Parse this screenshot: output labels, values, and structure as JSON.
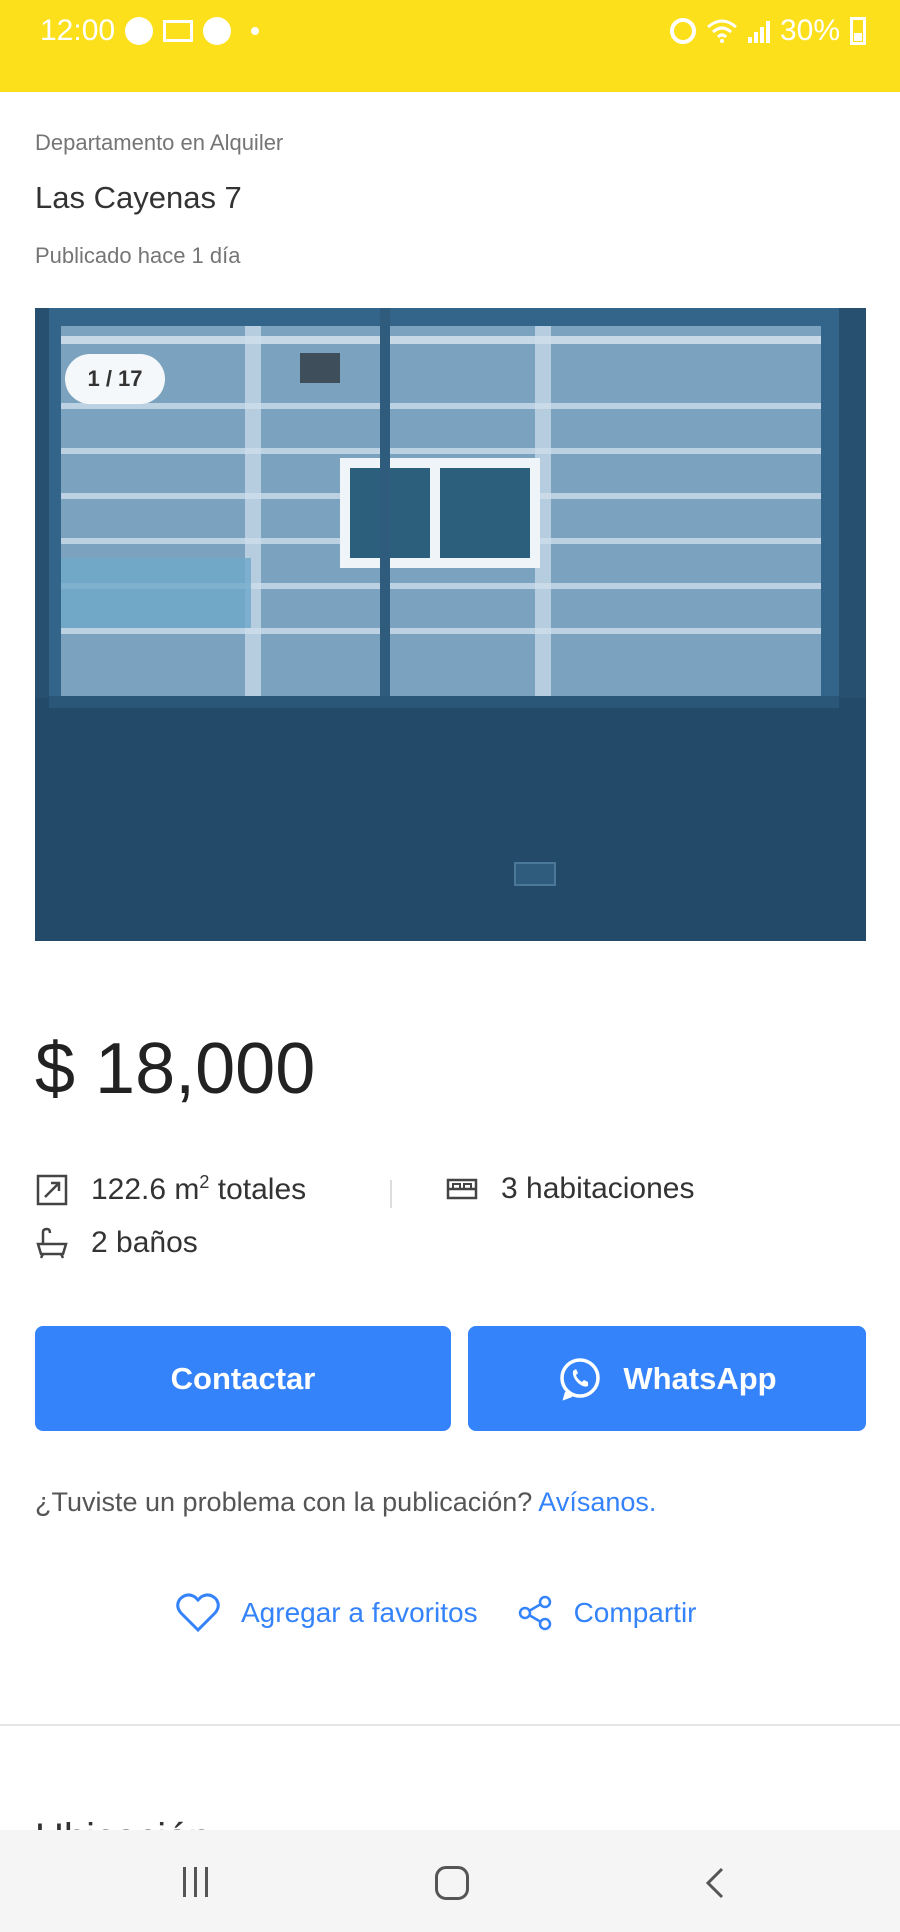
{
  "status_bar": {
    "time": "12:00",
    "battery": "30%"
  },
  "listing": {
    "category": "Departamento en Alquiler",
    "title": "Las Cayenas 7",
    "published": "Publicado hace 1 día",
    "photo_counter": "1 / 17",
    "price": "$ 18,000"
  },
  "features": {
    "area_value": "122.6 m",
    "area_sup": "2",
    "area_suffix": " totales",
    "rooms": "3 habitaciones",
    "baths": "2 baños"
  },
  "buttons": {
    "contact": "Contactar",
    "whatsapp": "WhatsApp"
  },
  "problem": {
    "text": "¿Tuviste un problema con la publicación? ",
    "link": "Avísanos."
  },
  "actions": {
    "favorite": "Agregar a favoritos",
    "share": "Compartir"
  },
  "section": {
    "next_heading": "Ubicación"
  },
  "colors": {
    "brand_yellow": "#fce01b",
    "accent_blue": "#3483fa"
  },
  "icons": [
    "chrome-icon",
    "gmail-icon",
    "alarm-icon",
    "wifi-icon",
    "signal-icon",
    "battery-icon",
    "area-icon",
    "bed-icon",
    "bathtub-icon",
    "whatsapp-icon",
    "heart-icon",
    "share-icon",
    "recents-icon",
    "home-icon",
    "back-icon"
  ]
}
